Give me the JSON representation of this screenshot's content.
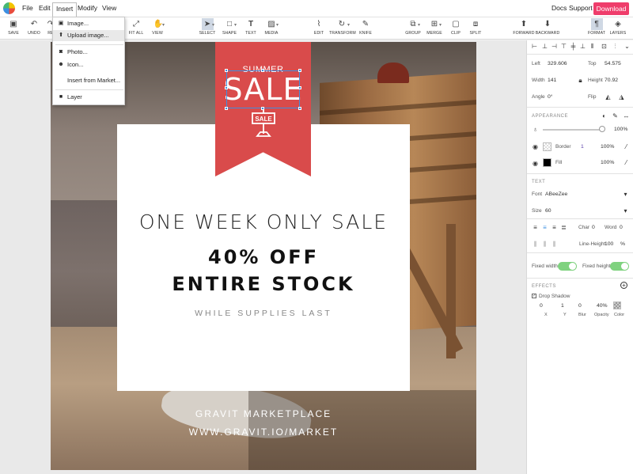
{
  "menubar": {
    "items": [
      "File",
      "Edit",
      "Insert",
      "Modify",
      "View"
    ],
    "links": [
      "Docs",
      "Support"
    ],
    "download_label": "Download"
  },
  "toolbar": {
    "save": "SAVE",
    "undo": "UNDO",
    "redo": "RE",
    "fit_all": "FIT ALL",
    "view": "VIEW",
    "select": "SELECT",
    "shape": "SHAPE",
    "text": "TEXT",
    "media": "MEDIA",
    "edit": "EDIT",
    "transform": "TRANSFORM",
    "knife": "KNIFE",
    "group": "GROUP",
    "merge": "MERGE",
    "clip": "CLIP",
    "split": "SPLIT",
    "forward": "FORWARD",
    "backward": "BACKWARD",
    "format": "FORMAT",
    "layers": "LAYERS"
  },
  "insert_menu": {
    "items": [
      "Image...",
      "Upload image...",
      "Photo...",
      "Icon...",
      "Insert from Market...",
      "Layer"
    ]
  },
  "artboard": {
    "banner_top": "SUMMER",
    "banner_main": "SALE",
    "sign_text": "SALE",
    "headline": "ONE WEEK ONLY SALE",
    "offer": "40% OFF",
    "stock": "ENTIRE STOCK",
    "supplies": "WHILE SUPPLIES LAST",
    "marketplace": "GRAVIT MARKETPLACE",
    "url": "WWW.GRAVIT.IO/MARKET"
  },
  "panel": {
    "left_label": "Left",
    "left_value": "329.606",
    "top_label": "Top",
    "top_value": "54.575",
    "width_label": "Width",
    "width_value": "141",
    "height_label": "Height",
    "height_value": "70.92",
    "angle_label": "Angle",
    "angle_value": "0°",
    "flip_label": "Flip",
    "appearance_header": "APPEARANCE",
    "opacity_value": "100%",
    "border_label": "Border",
    "border_width": "1",
    "border_opacity": "100%",
    "fill_label": "Fill",
    "fill_opacity": "100%",
    "text_header": "TEXT",
    "font_label": "Font",
    "font_value": "ABeeZee",
    "size_label": "Size",
    "size_value": "60",
    "char_label": "Char",
    "char_value": "0",
    "word_label": "Word",
    "word_value": "0",
    "line_height_label": "Line-Height",
    "line_height_value": "100",
    "line_height_unit": "%",
    "fixed_width_label": "Fixed width",
    "fixed_height_label": "Fixed height",
    "effects_header": "EFFECTS",
    "drop_shadow_label": "Drop Shadow",
    "shadow_x": "0",
    "shadow_y": "1",
    "shadow_blur": "0",
    "shadow_opacity": "40%",
    "shadow_labels": [
      "X",
      "Y",
      "Blur",
      "Opacity",
      "Color"
    ]
  },
  "colors": {
    "download_button": "#ef3d6b",
    "banner": "#d94b4b",
    "selection": "#3d8fe0",
    "toggle_on": "#7fd27f"
  }
}
